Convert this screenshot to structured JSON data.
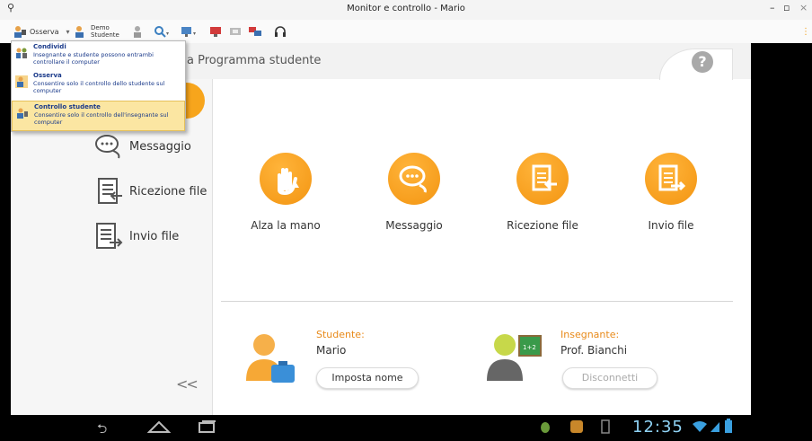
{
  "window": {
    "title": "Monitor e controllo - Mario",
    "minimize": "–",
    "restore": "▫",
    "close": "×"
  },
  "toolbar": {
    "mode_label": "Osserva",
    "demo_label_line1": "Demo",
    "demo_label_line2": "Studente"
  },
  "dropdown": {
    "items": [
      {
        "title": "Condividi",
        "desc": "Insegnante e studente possono entrambi controllare il computer"
      },
      {
        "title": "Osserva",
        "desc": "Consentire solo il controllo dello studente sul computer"
      },
      {
        "title": "Controllo studente",
        "desc": "Consentire solo il controllo dell'insegnante sul computer"
      }
    ]
  },
  "app": {
    "title_partial": "a",
    "title": "Programma studente",
    "help": "?"
  },
  "sidebar": {
    "items": [
      {
        "label": "Messaggio"
      },
      {
        "label": "Ricezione file"
      },
      {
        "label": "Invio file"
      }
    ],
    "collapse": "<<"
  },
  "actions": [
    {
      "label": "Alza la mano"
    },
    {
      "label": "Messaggio"
    },
    {
      "label": "Ricezione file"
    },
    {
      "label": "Invio file"
    }
  ],
  "student": {
    "role_label": "Studente:",
    "name": "Mario",
    "button": "Imposta nome"
  },
  "teacher": {
    "role_label": "Insegnante:",
    "name": "Prof. Bianchi",
    "button": "Disconnetti"
  },
  "statusbar": {
    "time": "12:35"
  },
  "colors": {
    "accent": "#f39512",
    "accent_light": "#ffb43a"
  }
}
